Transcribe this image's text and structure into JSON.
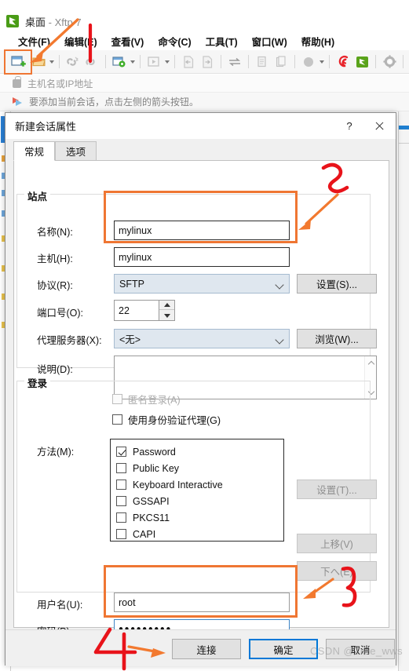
{
  "app": {
    "title_main": "桌面",
    "title_sep": " - ",
    "title_app": "Xftp 7",
    "icon": "xftp-app-icon"
  },
  "menubar": {
    "items": [
      {
        "label": "文件(F)",
        "name": "menu-file"
      },
      {
        "label": "编辑(E)",
        "name": "menu-edit"
      },
      {
        "label": "查看(V)",
        "name": "menu-view"
      },
      {
        "label": "命令(C)",
        "name": "menu-command"
      },
      {
        "label": "工具(T)",
        "name": "menu-tools"
      },
      {
        "label": "窗口(W)",
        "name": "menu-window"
      },
      {
        "label": "帮助(H)",
        "name": "menu-help"
      }
    ]
  },
  "toolbar": {
    "new_session_icon": "new-session-icon",
    "open_folder_icon": "open-folder-icon",
    "disconnect_icon": "disconnect-icon",
    "connect_icon": "connect-icon",
    "session_settings_icon": "session-settings-icon",
    "transfer_icon": "transfer-run-icon",
    "upload_icon": "upload-icon",
    "download_icon": "download-icon",
    "sync_icon": "sync-icon",
    "copy_icon": "copy-icon",
    "paste_icon": "paste-icon",
    "circle_icon": "view-mode-icon",
    "xshell_icon": "xshell-icon",
    "xftp_icon": "xftp-icon",
    "gear_icon": "options-gear-icon",
    "help_icon": "help-question-icon"
  },
  "address_bar": {
    "placeholder": "主机名或IP地址",
    "lock_icon": "lock-icon"
  },
  "hint_bar": {
    "text": "要添加当前会话，点击左侧的箭头按钮。",
    "icon": "arrow-flag-icon"
  },
  "dialog": {
    "title": "新建会话属性",
    "help_button": "?",
    "close_button": "close-icon",
    "tabs": [
      {
        "label": "常规",
        "name": "tab-general",
        "active": true
      },
      {
        "label": "选项",
        "name": "tab-options",
        "active": false
      }
    ],
    "site": {
      "group_label": "站点",
      "name_label": "名称(N):",
      "name_value": "mylinux",
      "host_label": "主机(H):",
      "host_value": "mylinux",
      "protocol_label": "协议(R):",
      "protocol_value": "SFTP",
      "protocol_settings_button": "设置(S)...",
      "port_label": "端口号(O):",
      "port_value": "22",
      "proxy_label": "代理服务器(X):",
      "proxy_value": "<无>",
      "proxy_browse_button": "浏览(W)...",
      "description_label": "说明(D):",
      "description_value": ""
    },
    "login": {
      "group_label": "登录",
      "anonymous_label": "匿名登录(A)",
      "anonymous_checked": false,
      "anonymous_disabled": true,
      "use_agent_label": "使用身份验证代理(G)",
      "use_agent_checked": false,
      "method_label": "方法(M):",
      "methods": [
        {
          "label": "Password",
          "checked": true
        },
        {
          "label": "Public Key",
          "checked": false
        },
        {
          "label": "Keyboard Interactive",
          "checked": false
        },
        {
          "label": "GSSAPI",
          "checked": false
        },
        {
          "label": "PKCS11",
          "checked": false
        },
        {
          "label": "CAPI",
          "checked": false
        }
      ],
      "method_settings_button": "设置(T)...",
      "move_up_button": "上移(V)",
      "move_down_button": "下へ(E)",
      "username_label": "用户名(U):",
      "username_value": "root",
      "password_label": "密码(P):",
      "password_value": "●●●●●●●●●"
    },
    "buttons": {
      "connect": "连接",
      "ok": "确定",
      "cancel": "取消"
    }
  },
  "annotations": {
    "step2": "2",
    "step3": "3",
    "step4": "4",
    "highlight_color": "#ef7633",
    "mark_color": "#e8131a"
  },
  "watermark": {
    "text": "CSDN @Tree_wws"
  }
}
